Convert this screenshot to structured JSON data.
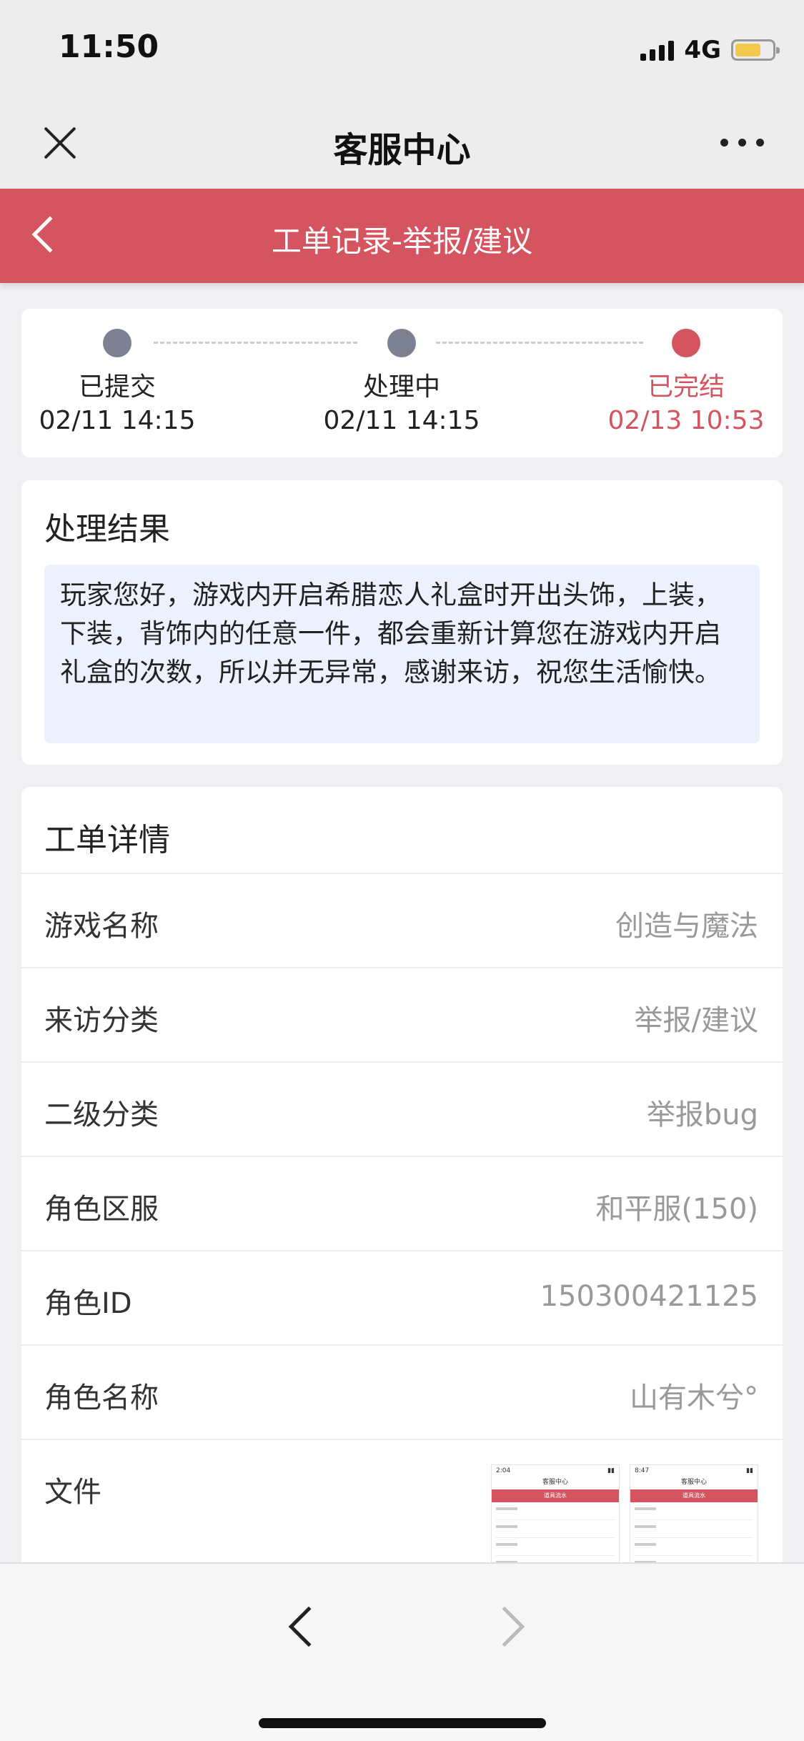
{
  "status_bar": {
    "time": "11:50",
    "network": "4G",
    "battery_level": 0.7
  },
  "nav": {
    "title": "客服中心",
    "close_icon": "close-icon",
    "more_icon": "more-icon"
  },
  "header": {
    "title": "工单记录-举报/建议",
    "back_icon": "chevron-left-icon"
  },
  "progress": {
    "steps": [
      {
        "label": "已提交",
        "time": "02/11 14:15",
        "status": "done"
      },
      {
        "label": "处理中",
        "time": "02/11 14:15",
        "status": "done"
      },
      {
        "label": "已完结",
        "time": "02/13 10:53",
        "status": "current"
      }
    ],
    "active_color": "#d45560",
    "inactive_color": "#7d8090"
  },
  "result": {
    "title": "处理结果",
    "text": "玩家您好，游戏内开启希腊恋人礼盒时开出头饰，上装，下装，背饰内的任意一件，都会重新计算您在游戏内开启礼盒的次数，所以并无异常，感谢来访，祝您生活愉快。"
  },
  "details": {
    "title": "工单详情",
    "rows": [
      {
        "label": "游戏名称",
        "value": "创造与魔法"
      },
      {
        "label": "来访分类",
        "value": "举报/建议"
      },
      {
        "label": "二级分类",
        "value": "举报bug"
      },
      {
        "label": "角色区服",
        "value": "和平服(150)"
      },
      {
        "label": "角色ID",
        "value": "150300421125"
      },
      {
        "label": "角色名称",
        "value": "山有木兮°"
      }
    ],
    "file_label": "文件",
    "files": [
      {
        "time": "2:04",
        "title": "客服中心",
        "sub": "道具流水"
      },
      {
        "time": "8:47",
        "title": "客服中心",
        "sub": "道具流水"
      }
    ]
  },
  "toolbar": {
    "back_icon": "chevron-left-icon",
    "forward_icon": "chevron-right-icon"
  },
  "colors": {
    "brand_red": "#d45560",
    "result_bg": "#edf1fd"
  }
}
